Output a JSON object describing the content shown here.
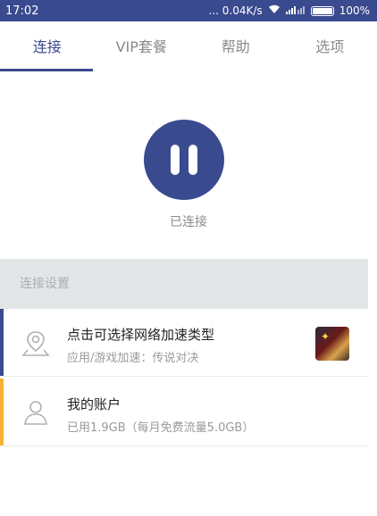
{
  "statusbar": {
    "time": "17:02",
    "net_speed": "... 0.04K/s",
    "battery": "100%",
    "icons": [
      "wifi-icon",
      "signal-icon",
      "battery-icon"
    ]
  },
  "tabs": [
    {
      "label": "连接",
      "active": true
    },
    {
      "label": "VIP套餐",
      "active": false
    },
    {
      "label": "帮助",
      "active": false
    },
    {
      "label": "选项",
      "active": false
    }
  ],
  "connection": {
    "status_text": "已连接",
    "button_icon": "pause-icon"
  },
  "settings": {
    "header": "连接设置",
    "rows": [
      {
        "title": "点击可选择网络加速类型",
        "subtitle": "应用/游戏加速：传说对决",
        "icon": "location-pin-icon",
        "accent_color": "#3a4a8f"
      },
      {
        "title": "我的账户",
        "subtitle": "已用1.9GB（每月免费流量5.0GB）",
        "icon": "user-icon",
        "accent_color": "#f5b335"
      }
    ]
  },
  "colors": {
    "brand": "#3a4a8f",
    "accent_yellow": "#f5b335"
  }
}
